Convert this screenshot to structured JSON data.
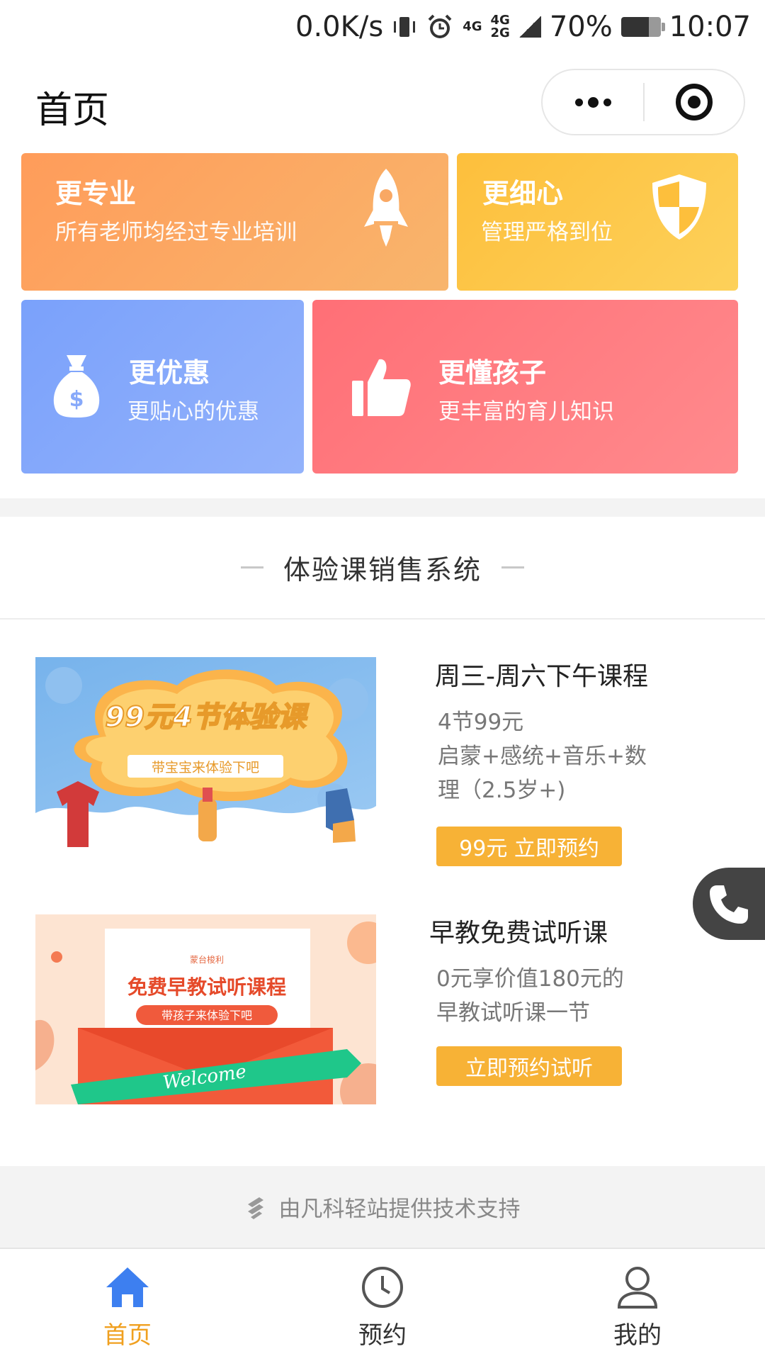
{
  "status_bar": {
    "net_speed": "0.0K/s",
    "battery": "70%",
    "time": "10:07",
    "net_label_top": "4G",
    "net_label_top2": "4G",
    "net_label_bottom": "2G"
  },
  "nav": {
    "title": "首页"
  },
  "features": [
    {
      "title": "更专业",
      "subtitle": "所有老师均经过专业培训",
      "icon": "rocket-icon",
      "color": "#ff9c5a"
    },
    {
      "title": "更细心",
      "subtitle": "管理严格到位",
      "icon": "shield-icon",
      "color": "#fdbf3c"
    },
    {
      "title": "更优惠",
      "subtitle": "更贴心的优惠",
      "icon": "money-bag-icon",
      "color": "#7aa1fb"
    },
    {
      "title": "更懂孩子",
      "subtitle": "更丰富的育儿知识",
      "icon": "thumbs-up-icon",
      "color": "#ff6f76"
    }
  ],
  "section": {
    "title": "体验课销售系统"
  },
  "courses": [
    {
      "title": "周三-周六下午课程",
      "desc": "4节99元\n启蒙+感统+音乐+数\n理（2.5岁+)",
      "button": "99元 立即预约",
      "banner_title": "99元4节体验课",
      "banner_sub": "带宝宝来体验下吧"
    },
    {
      "title": "早教免费试听课",
      "desc": "0元享价值180元的\n早教试听课一节",
      "button": "立即预约试听",
      "banner_small": "蒙台梭利",
      "banner_title": "免费早教试听课程",
      "banner_sub": "带孩子来体验下吧",
      "banner_ribbon": "Welcome"
    }
  ],
  "footer": {
    "powered_by": "由凡科轻站提供技术支持"
  },
  "tabs": [
    {
      "label": "首页",
      "icon": "home-icon",
      "active": true
    },
    {
      "label": "预约",
      "icon": "clock-icon",
      "active": false
    },
    {
      "label": "我的",
      "icon": "user-icon",
      "active": false
    }
  ],
  "colors": {
    "accent": "#f0a020",
    "tab_active_icon": "#3d7ff0",
    "button": "#f7b236"
  }
}
